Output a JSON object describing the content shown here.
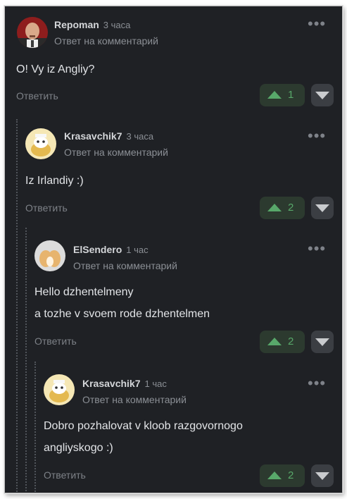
{
  "comments": [
    {
      "author": "Repoman",
      "time": "3 часа",
      "reply_to": "Ответ на комментарий",
      "lines": [
        "O! Vy iz Angliy?"
      ],
      "reply_label": "Ответить",
      "votes": "1",
      "avatar": "bald-man-avatar-icon"
    },
    {
      "author": "Krasavchik7",
      "time": "3 часа",
      "reply_to": "Ответ на комментарий",
      "lines": [
        "Iz Irlandiy :)"
      ],
      "reply_label": "Ответить",
      "votes": "2",
      "avatar": "cat-cartoon-avatar-icon"
    },
    {
      "author": "ElSendero",
      "time": "1 час",
      "reply_to": "Ответ на комментарий",
      "lines": [
        "Hello dzhentelmeny",
        "a tozhe v svoem rode dzhentelmen"
      ],
      "reply_label": "Ответить",
      "votes": "2",
      "avatar": "corgi-avatar-icon"
    },
    {
      "author": "Krasavchik7",
      "time": "1 час",
      "reply_to": "Ответ на комментарий",
      "lines": [
        "Dobro pozhalovat v kloob razgovornogo",
        "angliyskogo :)"
      ],
      "reply_label": "Ответить",
      "votes": "2",
      "avatar": "cat-cartoon-avatar-icon"
    }
  ],
  "menu_icon": "more-dots-icon",
  "colors": {
    "background": "#1f2125",
    "upvote": "#58a86a",
    "secondary_text": "#8b8f95",
    "primary_text": "#e2e4e7"
  }
}
